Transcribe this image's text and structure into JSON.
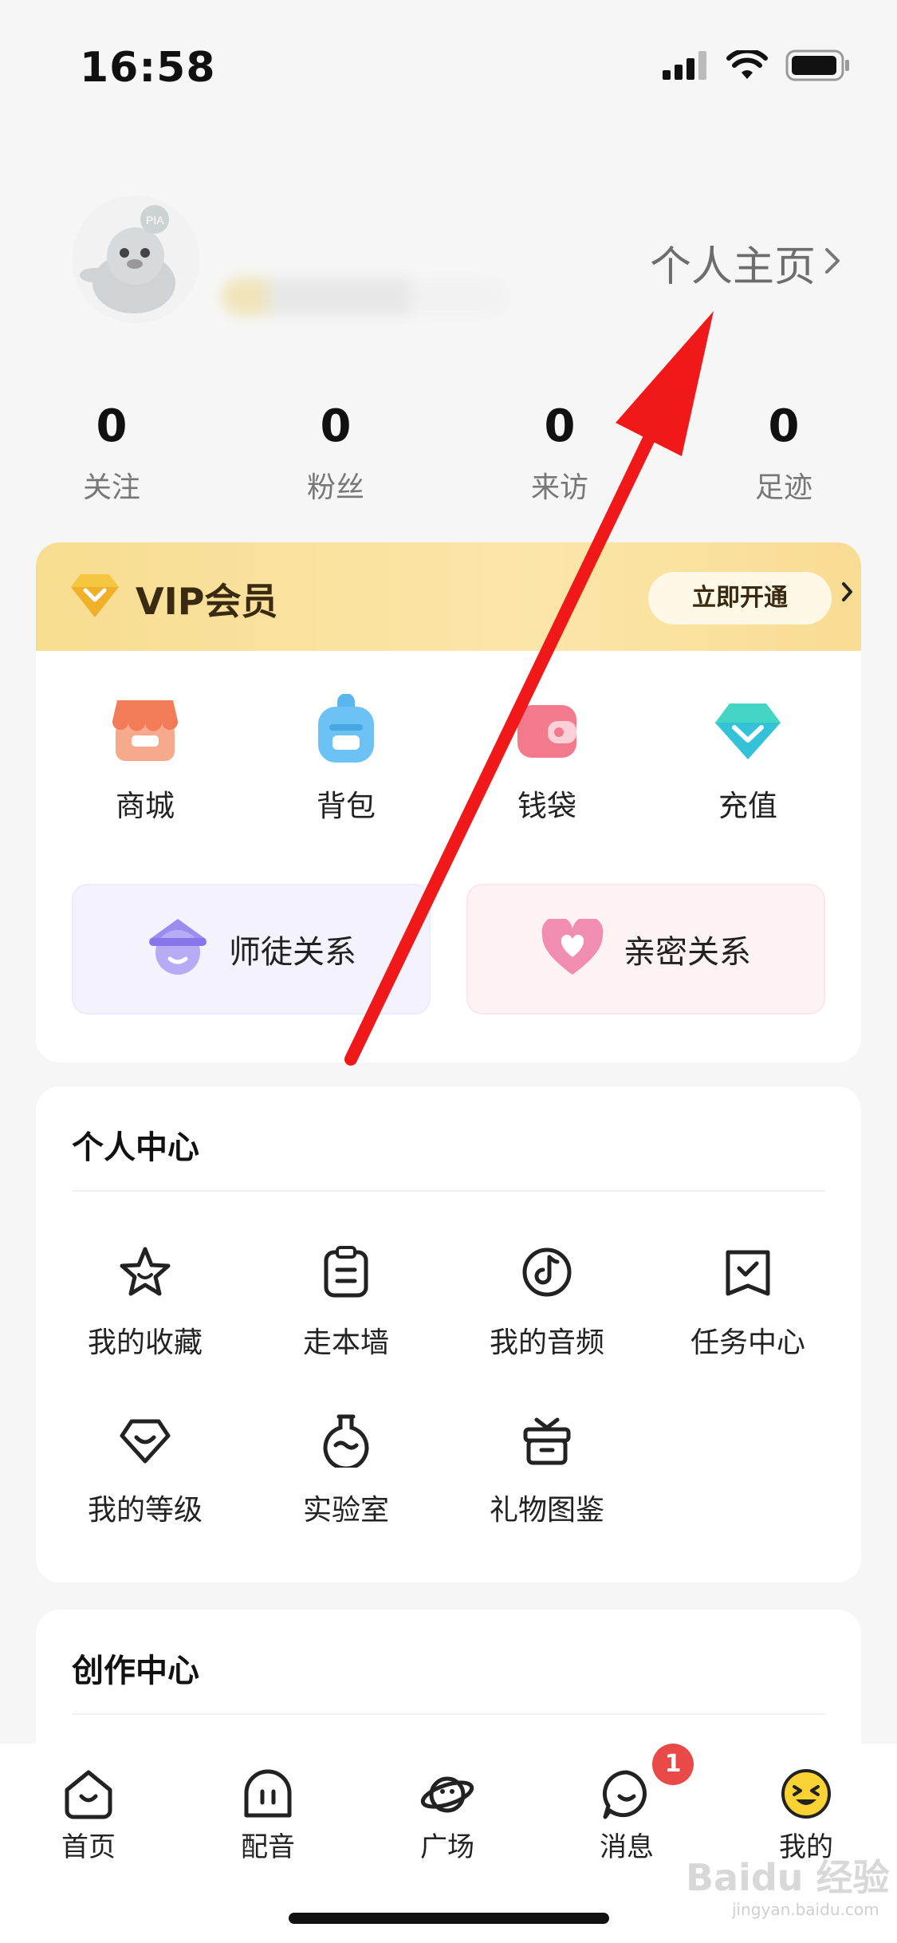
{
  "status_bar": {
    "time": "16:58"
  },
  "profile": {
    "homepage_link": "个人主页"
  },
  "stats": [
    {
      "value": "0",
      "label": "关注"
    },
    {
      "value": "0",
      "label": "粉丝"
    },
    {
      "value": "0",
      "label": "来访"
    },
    {
      "value": "0",
      "label": "足迹"
    }
  ],
  "vip": {
    "title": "VIP会员",
    "button": "立即开通"
  },
  "quick_actions": [
    {
      "label": "商城",
      "icon": "shop-icon"
    },
    {
      "label": "背包",
      "icon": "backpack-icon"
    },
    {
      "label": "钱袋",
      "icon": "wallet-icon"
    },
    {
      "label": "充值",
      "icon": "diamond-icon"
    }
  ],
  "relations": [
    {
      "label": "师徒关系",
      "icon": "mentor-icon"
    },
    {
      "label": "亲密关系",
      "icon": "heart-icon"
    }
  ],
  "personal_center": {
    "title": "个人中心",
    "items": [
      {
        "label": "我的收藏",
        "icon": "star-icon"
      },
      {
        "label": "走本墙",
        "icon": "clipboard-icon"
      },
      {
        "label": "我的音频",
        "icon": "audio-icon"
      },
      {
        "label": "任务中心",
        "icon": "task-icon"
      },
      {
        "label": "我的等级",
        "icon": "level-icon"
      },
      {
        "label": "实验室",
        "icon": "lab-icon"
      },
      {
        "label": "礼物图鉴",
        "icon": "gift-icon"
      }
    ]
  },
  "creation_center": {
    "title": "创作中心"
  },
  "tab_bar": {
    "tabs": [
      {
        "label": "首页",
        "icon": "home-icon"
      },
      {
        "label": "配音",
        "icon": "dubbing-icon"
      },
      {
        "label": "广场",
        "icon": "planet-icon"
      },
      {
        "label": "消息",
        "icon": "message-icon"
      },
      {
        "label": "我的",
        "icon": "me-icon"
      }
    ],
    "message_badge": "1"
  },
  "watermark": {
    "main": "Baidu 经验",
    "sub": "jingyan.baidu.com"
  },
  "colors": {
    "vip_gold": "#f8dd91",
    "badge_red": "#e94a47",
    "annotation_red": "#f01818",
    "accent_yellow": "#fbd233"
  }
}
